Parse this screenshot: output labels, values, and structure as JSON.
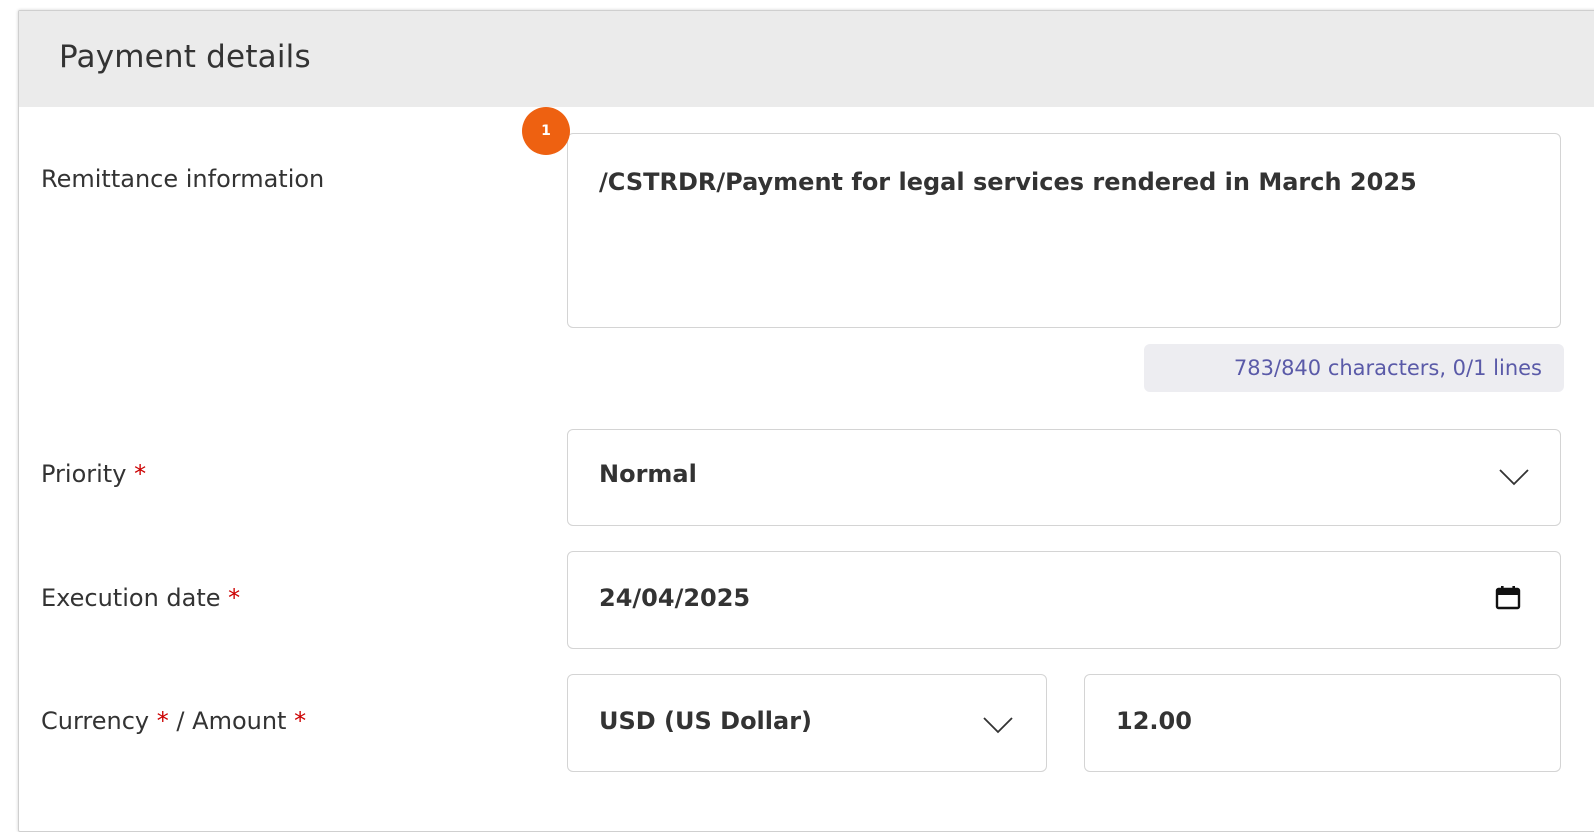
{
  "panel": {
    "title": "Payment details",
    "badge": "1"
  },
  "remittance": {
    "label": "Remittance information",
    "value": "/CSTRDR/Payment for legal services rendered in March 2025",
    "counter": "783/840 characters, 0/1 lines"
  },
  "priority": {
    "label": "Priority",
    "required_mark": "*",
    "value": "Normal",
    "icon": "chevron-down-icon"
  },
  "execution_date": {
    "label": "Execution date",
    "required_mark": "*",
    "value": "24/04/2025",
    "icon": "calendar-icon"
  },
  "currency_amount": {
    "currency_label": "Currency",
    "separator": "/",
    "amount_label": "Amount",
    "required_mark": "*",
    "currency_value": "USD (US Dollar)",
    "amount_value": "12.00",
    "icon": "chevron-down-icon"
  },
  "colors": {
    "accent": "#ee6111",
    "required": "#cc0000",
    "header_bg": "#ebebeb",
    "counter_bg": "#ededf1",
    "counter_text": "#5a5aa8"
  }
}
